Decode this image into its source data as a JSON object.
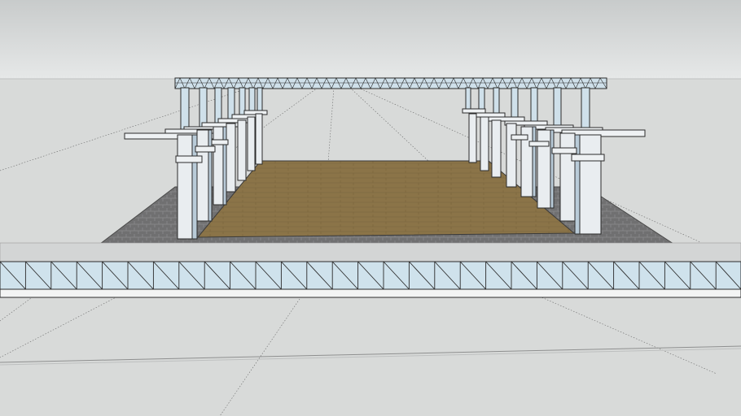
{
  "scene": {
    "colors": {
      "sky_top": "#c9cccc",
      "sky_bottom": "#e4e6e6",
      "ground": "#d7d9d8",
      "floor": "#8c7548",
      "paving": "#6f6f70",
      "column": "#e8ecef",
      "column_shade": "#b8cbd8",
      "truss": "#cfe0ea",
      "line": "#2b2b2b"
    }
  }
}
